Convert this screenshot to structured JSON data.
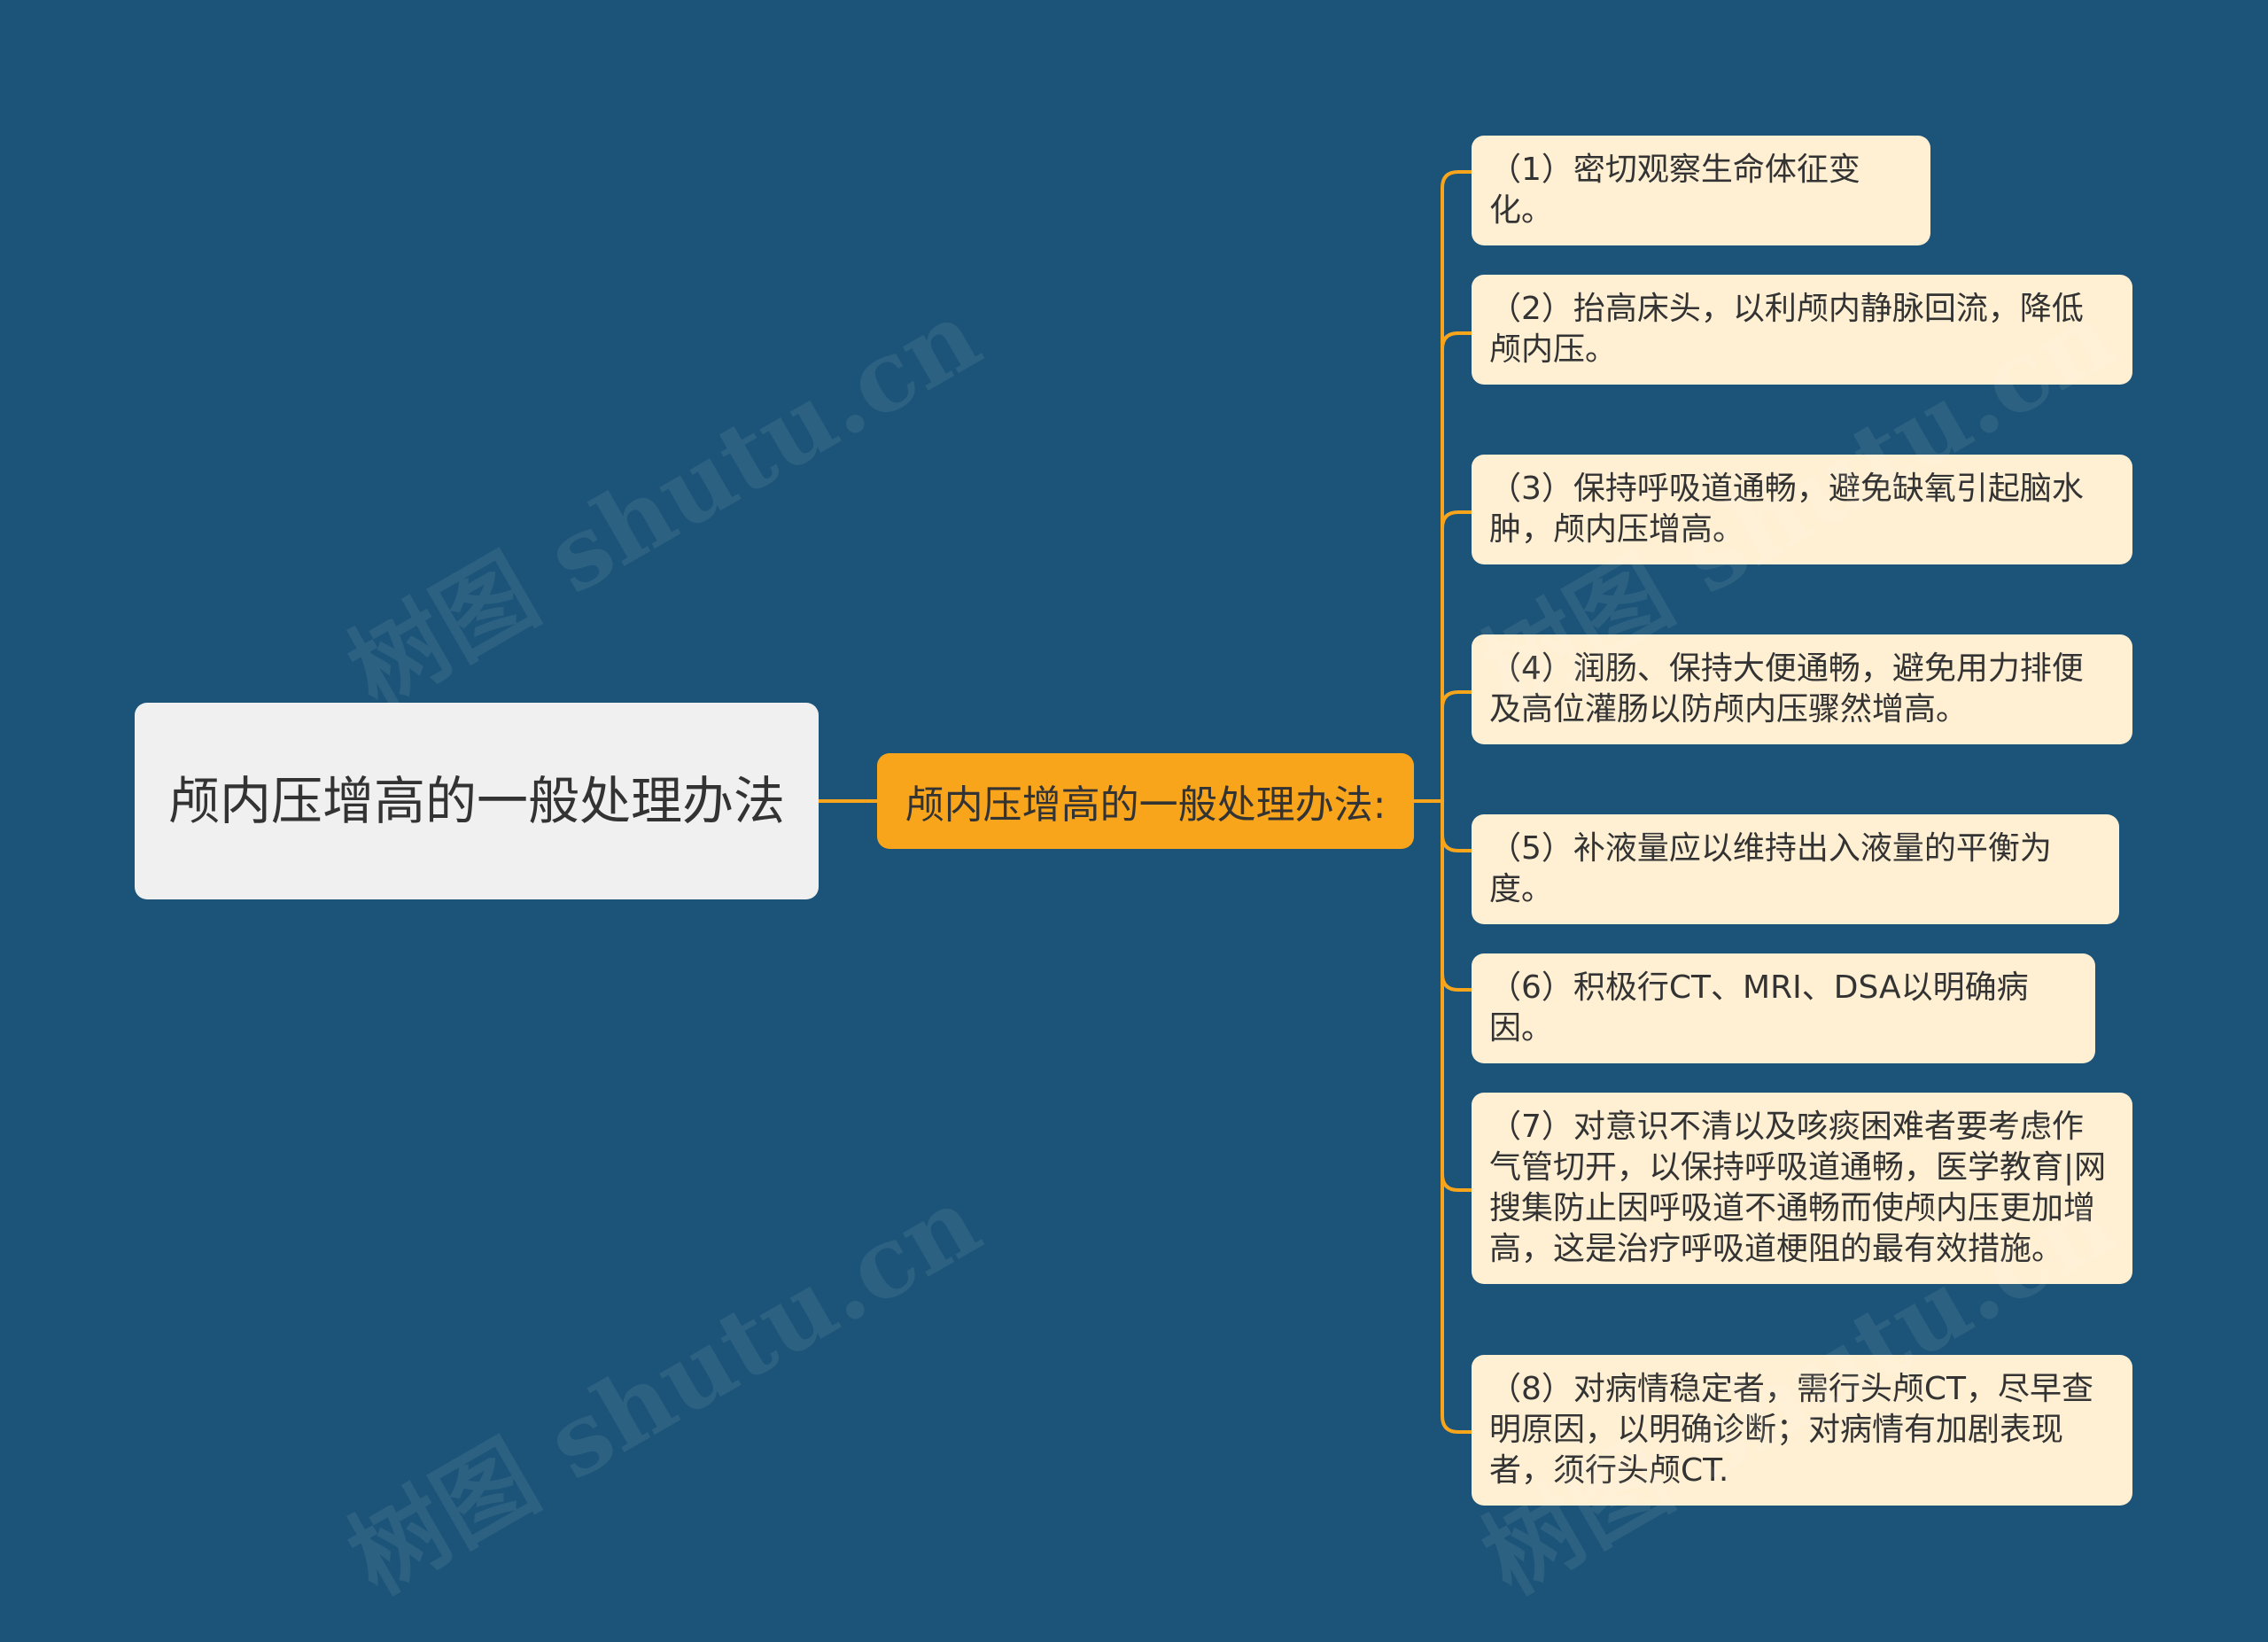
{
  "mindmap": {
    "root": "颅内压增高的一般处理办法",
    "branch": "颅内压增高的一般处理办法:",
    "leaves": [
      "（1）密切观察生命体征变化。",
      "（2）抬高床头，以利颅内静脉回流，降低颅内压。",
      "（3）保持呼吸道通畅，避免缺氧引起脑水肿，颅内压增高。",
      "（4）润肠、保持大便通畅，避免用力排便及高位灌肠以防颅内压骤然增高。",
      "（5）补液量应以维持出入液量的平衡为度。",
      "（6）积极行CT、MRI、DSA以明确病因。",
      "（7）对意识不清以及咳痰困难者要考虑作气管切开，以保持呼吸道通畅，医学教育|网搜集防止因呼吸道不通畅而使颅内压更加增高，这是治疗呼吸道梗阻的最有效措施。",
      "（8）对病情稳定者，需行头颅CT，尽早查明原因，以明确诊断；对病情有加剧表现者，须行头颅CT."
    ]
  },
  "watermark": "树图 shutu.cn",
  "colors": {
    "background": "#1b5478",
    "root_fill": "#f0f0f0",
    "branch_fill": "#f8a51c",
    "leaf_fill": "#fff0d4",
    "connector": "#f8a51c",
    "text": "#333333"
  }
}
